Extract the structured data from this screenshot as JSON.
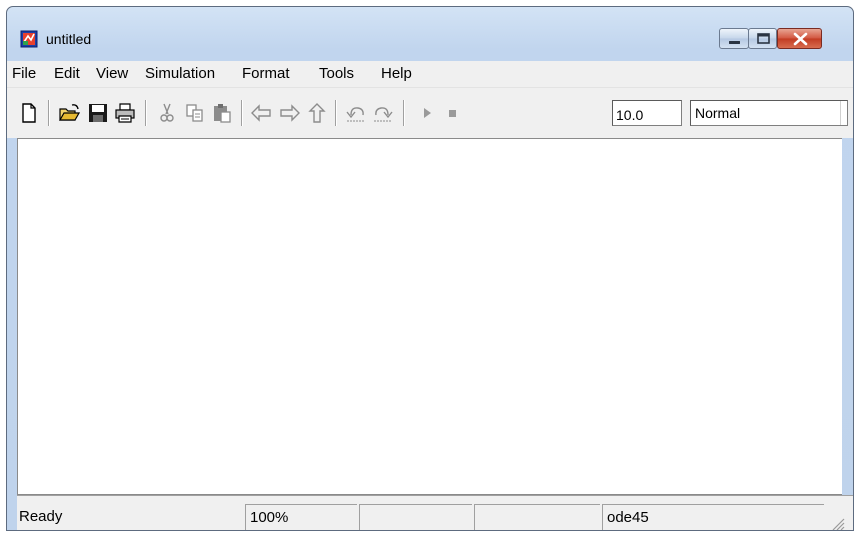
{
  "window": {
    "title": "untitled"
  },
  "menu": [
    "File",
    "Edit",
    "View",
    "Simulation",
    "Format",
    "Tools",
    "Help"
  ],
  "toolbar": {
    "icons": [
      "new-icon",
      "open-folder-icon",
      "save-icon",
      "print-icon",
      "cut-icon",
      "copy-icon",
      "paste-icon",
      "back-arrow-icon",
      "forward-arrow-icon",
      "up-arrow-icon",
      "undo-icon",
      "redo-icon",
      "play-icon",
      "stop-icon"
    ],
    "stop_time": "10.0",
    "sim_mode": "Normal"
  },
  "status": {
    "text": "Ready",
    "zoom": "100%",
    "solver": "ode45"
  },
  "colors": {
    "title_bar": "#c1d5ee",
    "close_button": "#c23b22",
    "chrome": "#f0f0f0"
  }
}
